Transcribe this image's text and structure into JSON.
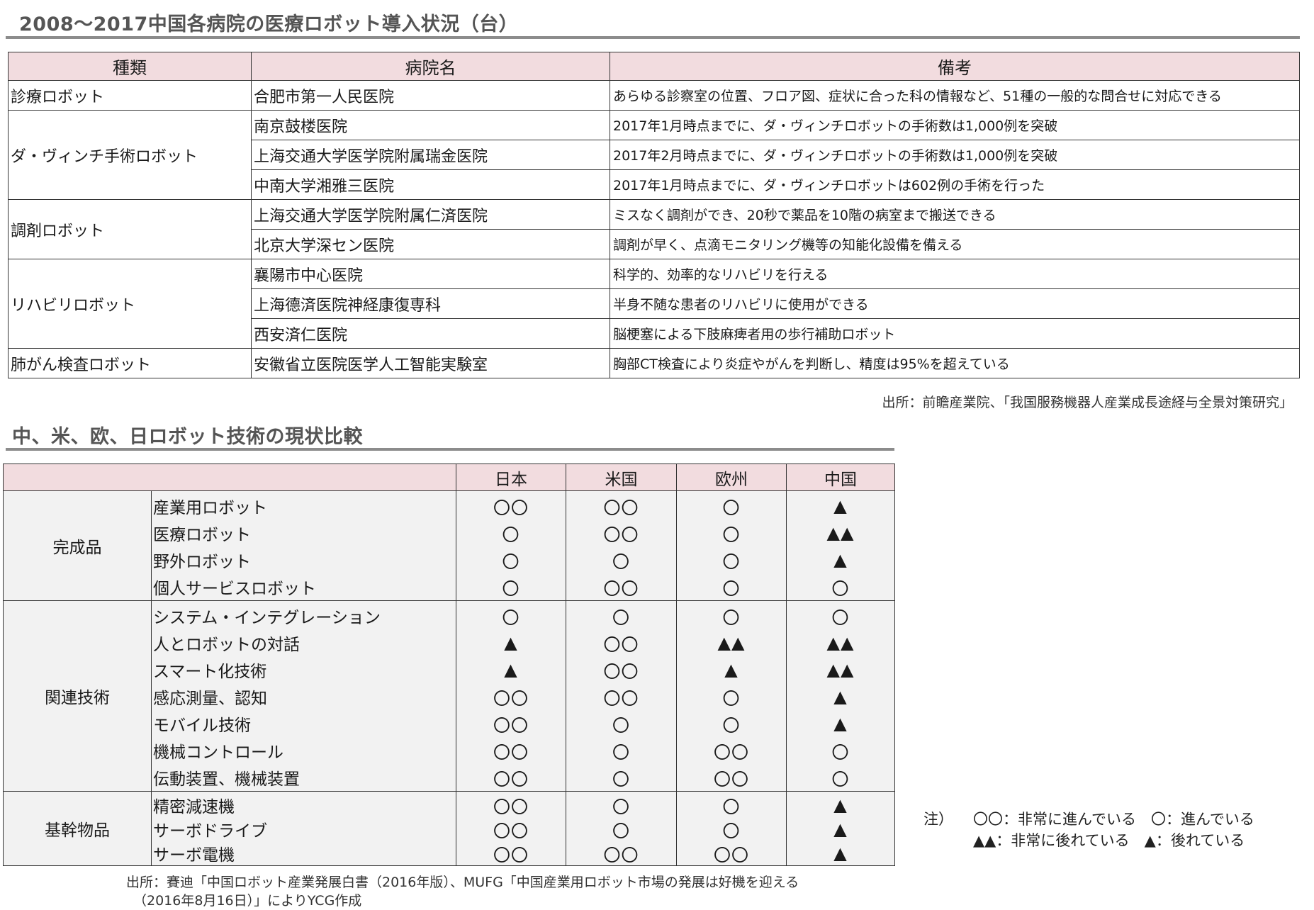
{
  "section1": {
    "title": "2008～2017中国各病院の医療ロボット導入状況（台）",
    "headers": [
      "種類",
      "病院名",
      "備考"
    ],
    "groups": [
      {
        "type": "診療ロボット",
        "rows": [
          {
            "hospital": "合肥市第一人民医院",
            "note": "あらゆる診察室の位置、フロア図、症状に合った科の情報など、51種の一般的な問合せに対応できる"
          }
        ]
      },
      {
        "type": "ダ・ヴィンチ手術ロボット",
        "rows": [
          {
            "hospital": "南京鼓楼医院",
            "note": "2017年1月時点までに、ダ・ヴィンチロボットの手術数は1,000例を突破"
          },
          {
            "hospital": "上海交通大学医学院附属瑞金医院",
            "note": "2017年2月時点までに、ダ・ヴィンチロボットの手術数は1,000例を突破"
          },
          {
            "hospital": "中南大学湘雅三医院",
            "note": "2017年1月時点までに、ダ・ヴィンチロボットは602例の手術を行った"
          }
        ]
      },
      {
        "type": "調剤ロボット",
        "rows": [
          {
            "hospital": "上海交通大学医学院附属仁済医院",
            "note": "ミスなく調剤ができ、20秒で薬品を10階の病室まで搬送できる"
          },
          {
            "hospital": "北京大学深セン医院",
            "note": "調剤が早く、点滴モニタリング機等の知能化設備を備える"
          }
        ]
      },
      {
        "type": "リハビリロボット",
        "rows": [
          {
            "hospital": "襄陽市中心医院",
            "note": "科学的、効率的なリハビリを行える"
          },
          {
            "hospital": "上海德済医院神経康復専科",
            "note": "半身不随な患者のリハビリに使用ができる"
          },
          {
            "hospital": "西安済仁医院",
            "note": "脳梗塞による下肢麻痺者用の歩行補助ロボット"
          }
        ]
      },
      {
        "type": "肺がん検査ロボット",
        "rows": [
          {
            "hospital": "安徽省立医院医学人工智能実験室",
            "note": "胸部CT検査により炎症やがんを判断し、精度は95%を超えている"
          }
        ]
      }
    ],
    "source": "出所：前瞻産業院、「我国服務機器人産業成長途経与全景対策研究」"
  },
  "section2": {
    "title": "中、米、欧、日ロボット技術の現状比較",
    "regions": [
      "日本",
      "米国",
      "欧州",
      "中国"
    ],
    "groups": [
      {
        "name": "完成品",
        "items": [
          {
            "label": "産業用ロボット",
            "values": [
              "〇〇",
              "〇〇",
              "〇",
              "▲"
            ]
          },
          {
            "label": "医療ロボット",
            "values": [
              "〇",
              "〇〇",
              "〇",
              "▲▲"
            ]
          },
          {
            "label": "野外ロボット",
            "values": [
              "〇",
              "〇",
              "〇",
              "▲"
            ]
          },
          {
            "label": "個人サービスロボット",
            "values": [
              "〇",
              "〇〇",
              "〇",
              "〇"
            ]
          }
        ]
      },
      {
        "name": "関連技術",
        "items": [
          {
            "label": "システム・インテグレーション",
            "values": [
              "〇",
              "〇",
              "〇",
              "〇"
            ]
          },
          {
            "label": "人とロボットの対話",
            "values": [
              "▲",
              "〇〇",
              "▲▲",
              "▲▲"
            ]
          },
          {
            "label": "スマート化技術",
            "values": [
              "▲",
              "〇〇",
              "▲",
              "▲▲"
            ]
          },
          {
            "label": "感応測量、認知",
            "values": [
              "〇〇",
              "〇〇",
              "〇",
              "▲"
            ]
          },
          {
            "label": "モバイル技術",
            "values": [
              "〇〇",
              "〇",
              "〇",
              "▲"
            ]
          },
          {
            "label": "機械コントロール",
            "values": [
              "〇〇",
              "〇",
              "〇〇",
              "〇"
            ]
          },
          {
            "label": "伝動装置、機械装置",
            "values": [
              "〇〇",
              "〇",
              "〇〇",
              "〇"
            ]
          }
        ]
      },
      {
        "name": "基幹物品",
        "items": [
          {
            "label": "精密減速機",
            "values": [
              "〇〇",
              "〇",
              "〇",
              "▲"
            ]
          },
          {
            "label": "サーボドライブ",
            "values": [
              "〇〇",
              "〇",
              "〇",
              "▲"
            ]
          },
          {
            "label": "サーボ電機",
            "values": [
              "〇〇",
              "〇〇",
              "〇〇",
              "▲"
            ]
          }
        ]
      }
    ],
    "legend": {
      "label": "注）",
      "line1": "〇〇：非常に進んでいる　〇：進んでいる",
      "line2": "▲▲：非常に後れている　▲：後れている"
    },
    "source_line1": "出所：賽迪「中国ロボット産業発展白書（2016年版）、MUFG「中国産業用ロボット市場の発展は好機を迎える",
    "source_line2": "（2016年8月16日）」によりYCG作成"
  }
}
